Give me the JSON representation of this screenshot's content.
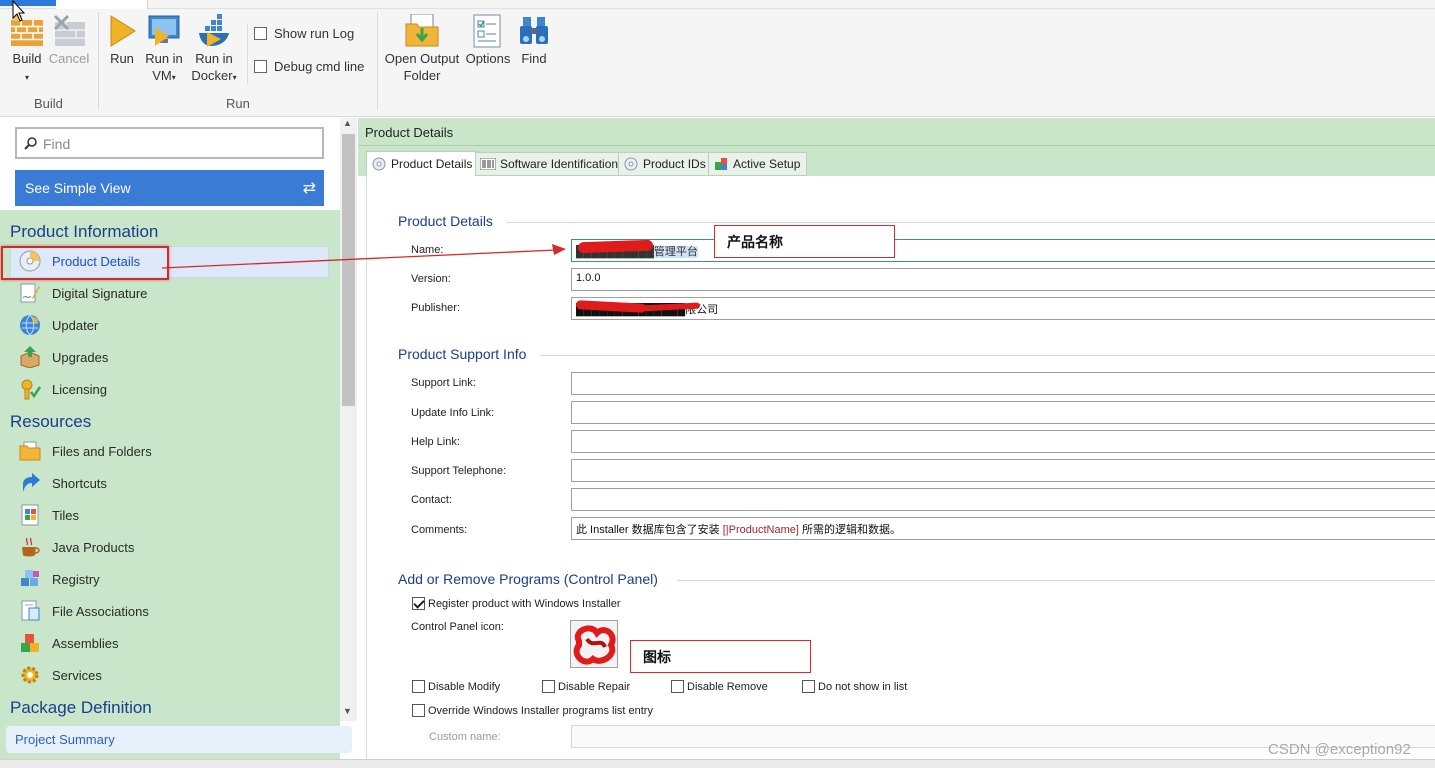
{
  "ribbon": {
    "buttons": {
      "build": "Build",
      "cancel": "Cancel",
      "run": "Run",
      "run_vm_1": "Run in",
      "run_vm_2": "VM",
      "run_docker_1": "Run in",
      "run_docker_2": "Docker",
      "open_output_1": "Open Output",
      "open_output_2": "Folder",
      "options": "Options",
      "find": "Find"
    },
    "checkboxes": {
      "show_run_log": "Show run Log",
      "debug_cmd_line": "Debug cmd line"
    },
    "groups": {
      "build": "Build",
      "run": "Run"
    },
    "dropdown_glyph": "▾"
  },
  "left": {
    "find_placeholder": "Find",
    "simple_view": "See Simple View",
    "switch_glyph": "⇄",
    "sections": {
      "product_information": "Product Information",
      "resources": "Resources",
      "package_definition": "Package Definition"
    },
    "product_items": [
      "Product Details",
      "Digital Signature",
      "Updater",
      "Upgrades",
      "Licensing"
    ],
    "resource_items": [
      "Files and Folders",
      "Shortcuts",
      "Tiles",
      "Java Products",
      "Registry",
      "File Associations",
      "Assemblies",
      "Services"
    ],
    "project_summary": "Project Summary",
    "scroll_up": "▲",
    "scroll_down": "▼"
  },
  "right": {
    "title": "Product Details",
    "tabs": [
      "Product Details",
      "Software Identification",
      "Product IDs",
      "Active Setup"
    ],
    "product_details": {
      "heading": "Product Details",
      "name_label": "Name:",
      "name_value": "██████████管理平台",
      "version_label": "Version:",
      "version_value": "1.0.0",
      "publisher_label": "Publisher:",
      "publisher_value": "██████████████限公司"
    },
    "support": {
      "heading": "Product Support Info",
      "support_link": "Support Link:",
      "update_info_link": "Update Info Link:",
      "help_link": "Help Link:",
      "support_telephone": "Support Telephone:",
      "contact": "Contact:",
      "comments": "Comments:",
      "comments_prefix": "此 Installer 数据库包含了安装 ",
      "comments_var": "[|ProductName]",
      "comments_suffix": " 所需的逻辑和数据。"
    },
    "arp": {
      "heading": "Add or Remove Programs (Control Panel)",
      "register": "Register product with Windows Installer",
      "control_panel_icon": "Control Panel icon:",
      "disable_modify": "Disable Modify",
      "disable_repair": "Disable Repair",
      "disable_remove": "Disable Remove",
      "do_not_show": "Do not show in list",
      "override": "Override Windows Installer programs list entry",
      "custom_name": "Custom name:"
    }
  },
  "annotations": {
    "product_name": "产品名称",
    "icon": "图标",
    "color": "#d62a2a"
  },
  "watermark": "CSDN @exception92",
  "colors": {
    "accent": "#3a7bd5",
    "panel_green": "#c9e6cb",
    "section_blue": "#1a3d8f"
  }
}
